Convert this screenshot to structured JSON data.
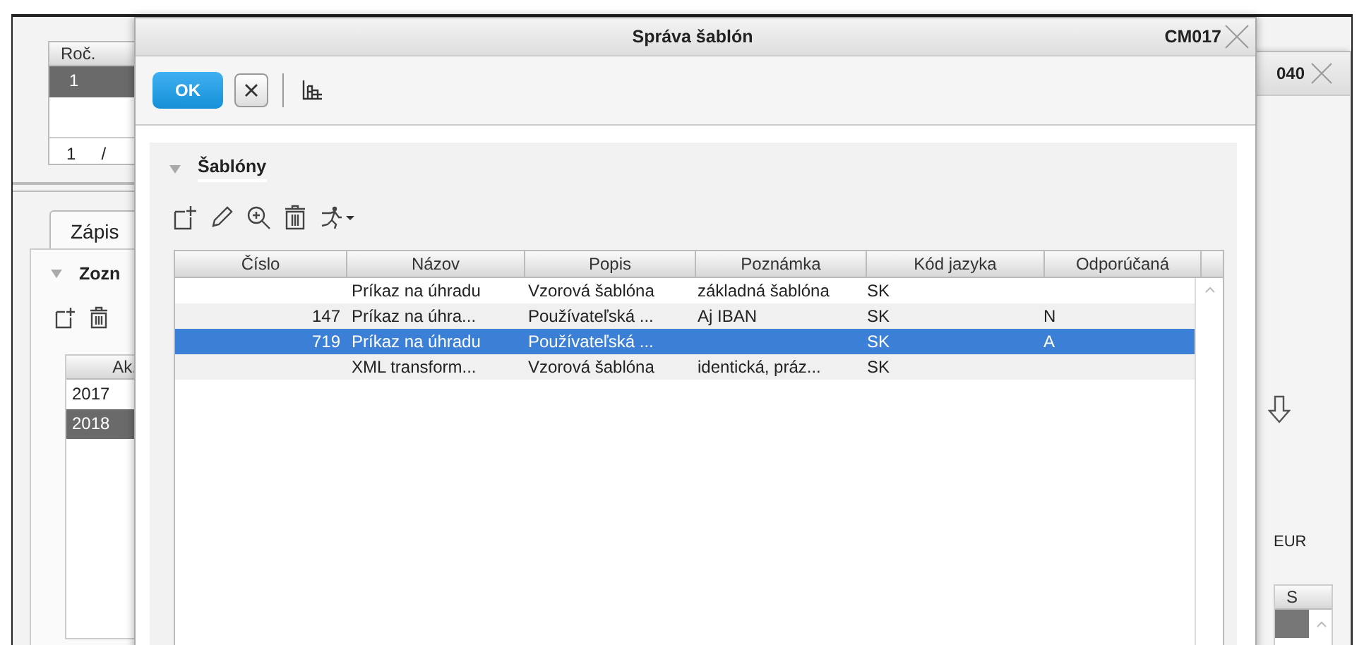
{
  "background_window": {
    "top_table": {
      "column": "Roč.",
      "rows": [
        {
          "value": "1",
          "selected": true
        }
      ],
      "pager": [
        "1",
        "/"
      ]
    },
    "tab": {
      "label": "Zápis",
      "selected": true
    },
    "section": {
      "title": "Zozn",
      "expanded": true
    },
    "list_table": {
      "column": "Ak.",
      "rows": [
        {
          "value": "2017",
          "selected": false
        },
        {
          "value": "2018",
          "selected": true
        }
      ]
    }
  },
  "back_dialog": {
    "title": "040",
    "currency": "EUR",
    "column": "S"
  },
  "dialog": {
    "title": "Správa šablón",
    "code": "CM017",
    "ok_label": "OK",
    "section": {
      "title": "Šablóny",
      "expanded": true
    },
    "table": {
      "columns": [
        "Číslo",
        "Názov",
        "Popis",
        "Poznámka",
        "Kód jazyka",
        "Odporúčaná"
      ],
      "rows": [
        {
          "cells": [
            null,
            "Príkaz na úhradu",
            "Vzorová šablóna",
            "základná šablóna",
            "SK",
            null
          ],
          "selected": false
        },
        {
          "cells": [
            "147",
            "Príkaz na úhra...",
            "Používateľská ...",
            "Aj IBAN",
            "SK",
            "N"
          ],
          "selected": false
        },
        {
          "cells": [
            "719",
            "Príkaz na úhradu",
            "Používateľská ...",
            null,
            "SK",
            "A"
          ],
          "selected": true
        },
        {
          "cells": [
            null,
            "XML transform...",
            "Vzorová šablóna",
            "identická, práz...",
            "SK",
            null
          ],
          "selected": false
        }
      ]
    }
  }
}
